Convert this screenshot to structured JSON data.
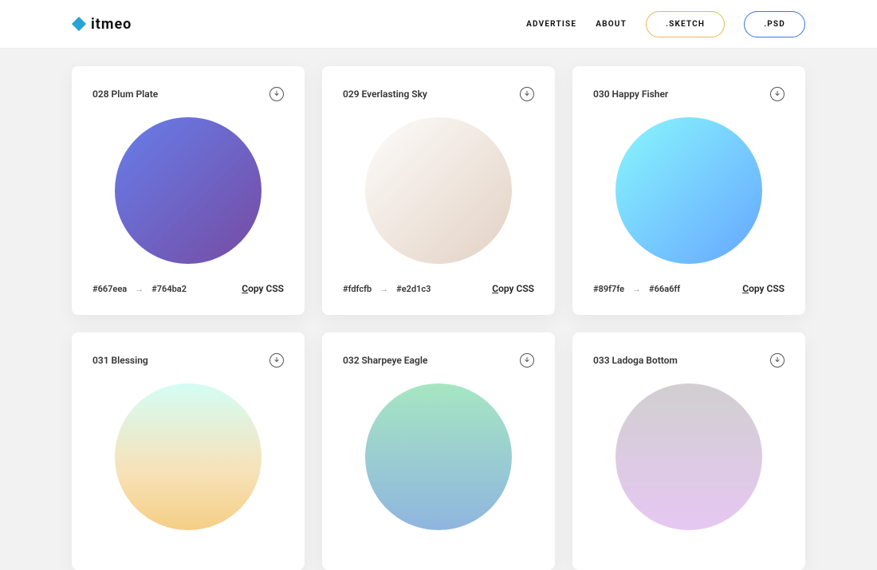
{
  "header": {
    "brand": "itmeo",
    "nav": {
      "advertise": "ADVERTISE",
      "about": "ABOUT"
    },
    "buttons": {
      "sketch": ".SKETCH",
      "psd": ".PSD"
    }
  },
  "copy_label_prefix": "C",
  "copy_label_rest": "opy CSS",
  "cards": [
    {
      "title": "028 Plum Plate",
      "c1": "#667eea",
      "c2": "#764ba2"
    },
    {
      "title": "029 Everlasting Sky",
      "c1": "#fdfcfb",
      "c2": "#e2d1c3"
    },
    {
      "title": "030 Happy Fisher",
      "c1": "#89f7fe",
      "c2": "#66a6ff"
    },
    {
      "title": "031 Blessing",
      "c1": "",
      "c2": ""
    },
    {
      "title": "032 Sharpeye Eagle",
      "c1": "",
      "c2": ""
    },
    {
      "title": "033 Ladoga Bottom",
      "c1": "",
      "c2": ""
    }
  ]
}
